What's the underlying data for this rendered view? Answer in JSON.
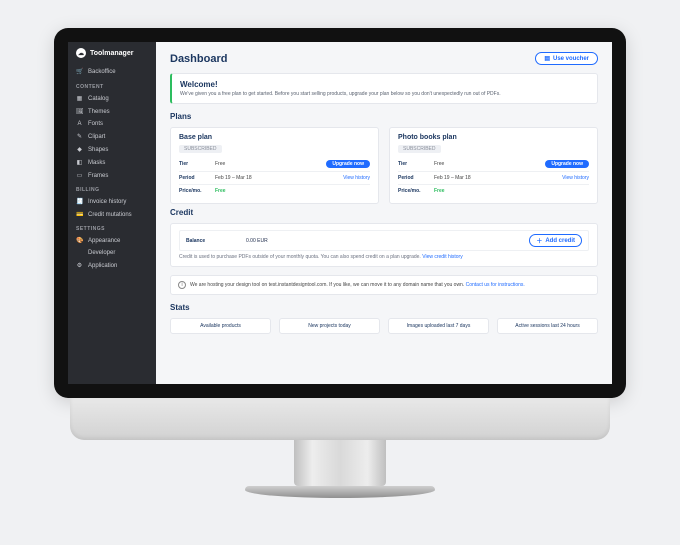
{
  "brand": {
    "name": "Toolmanager",
    "icon": "cloud"
  },
  "sidebar": {
    "top_item": {
      "label": "Backoffice",
      "icon": "🛒"
    },
    "groups": [
      {
        "title": "CONTENT",
        "items": [
          {
            "label": "Catalog",
            "icon": "▦"
          },
          {
            "label": "Themes",
            "icon": "🖼"
          },
          {
            "label": "Fonts",
            "icon": "A"
          },
          {
            "label": "Clipart",
            "icon": "✎"
          },
          {
            "label": "Shapes",
            "icon": "◆"
          },
          {
            "label": "Masks",
            "icon": "◧"
          },
          {
            "label": "Frames",
            "icon": "▭"
          }
        ]
      },
      {
        "title": "BILLING",
        "items": [
          {
            "label": "Invoice history",
            "icon": "🧾"
          },
          {
            "label": "Credit mutations",
            "icon": "💳"
          }
        ]
      },
      {
        "title": "SETTINGS",
        "items": [
          {
            "label": "Appearance",
            "icon": "🎨"
          },
          {
            "label": "Developer",
            "icon": "</>"
          },
          {
            "label": "Application",
            "icon": "⚙"
          }
        ]
      }
    ]
  },
  "header": {
    "title": "Dashboard",
    "use_voucher": "Use voucher"
  },
  "welcome": {
    "title": "Welcome!",
    "body": "We've given you a free plan to get started. Before you start selling products, upgrade your plan below so you don't unexpectedly run out of PDFs."
  },
  "plans": {
    "title": "Plans",
    "cards": [
      {
        "name": "Base plan",
        "badge": "SUBSCRIBED",
        "tier_k": "Tier",
        "tier_v": "Free",
        "upgrade": "Upgrade now",
        "period_k": "Period",
        "period_v": "Feb 19 – Mar 18",
        "history": "View history",
        "price_k": "Price/mo.",
        "price_v": "Free"
      },
      {
        "name": "Photo books plan",
        "badge": "SUBSCRIBED",
        "tier_k": "Tier",
        "tier_v": "Free",
        "upgrade": "Upgrade now",
        "period_k": "Period",
        "period_v": "Feb 19 – Mar 18",
        "history": "View history",
        "price_k": "Price/mo.",
        "price_v": "Free"
      }
    ]
  },
  "credit": {
    "title": "Credit",
    "balance_k": "Balance",
    "balance_v": "0.00 EUR",
    "add": "Add credit",
    "note_prefix": "Credit is used to purchase PDFs outside of your monthly quota. You can also spend credit on a plan upgrade. ",
    "note_link": "View credit history"
  },
  "banner": {
    "text_prefix": "We are hosting your design tool on test.instantdesigntool.com. If you like, we can move it to any domain name that you own. ",
    "link": "Contact us for instructions."
  },
  "stats": {
    "title": "Stats",
    "items": [
      "Available products",
      "New projects today",
      "Images uploaded last 7 days",
      "Active sessions last 24 hours"
    ]
  }
}
